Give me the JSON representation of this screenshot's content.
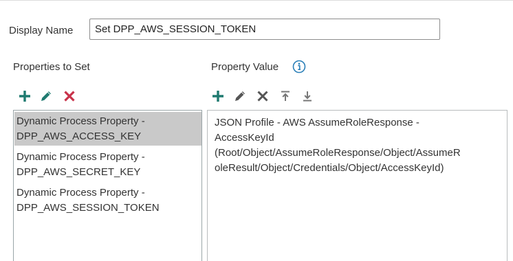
{
  "form": {
    "display_name_label": "Display Name",
    "display_name_value": "Set DPP_AWS_SESSION_TOKEN"
  },
  "properties_panel": {
    "title": "Properties to Set",
    "items": [
      {
        "line1": "Dynamic Process Property -",
        "line2": "DPP_AWS_ACCESS_KEY",
        "selected": true
      },
      {
        "line1": "Dynamic Process Property -",
        "line2": "DPP_AWS_SECRET_KEY",
        "selected": false
      },
      {
        "line1": "Dynamic Process Property -",
        "line2": "DPP_AWS_SESSION_TOKEN",
        "selected": false
      }
    ],
    "toolbar": {
      "add_icon": "plus-icon",
      "edit_icon": "pencil-icon",
      "delete_icon": "x-icon"
    }
  },
  "value_panel": {
    "title": "Property Value",
    "info_icon": "info-icon",
    "items": [
      {
        "lines": [
          "JSON Profile - AWS AssumeRoleResponse -",
          "AccessKeyId",
          "(Root/Object/AssumeRoleResponse/Object/AssumeR",
          "oleResult/Object/Credentials/Object/AccessKeyId)"
        ]
      }
    ],
    "toolbar": {
      "add_icon": "plus-icon",
      "edit_icon": "pencil-icon",
      "delete_icon": "x-icon",
      "move_top_icon": "move-to-top-icon",
      "move_bottom_icon": "move-to-bottom-icon"
    }
  },
  "colors": {
    "teal": "#1f7a70",
    "red": "#c8324a",
    "gray_icon": "#555555",
    "light_gray_icon": "#777777",
    "selected_bg": "#c9c9c9",
    "info_blue": "#2a7fb8"
  }
}
